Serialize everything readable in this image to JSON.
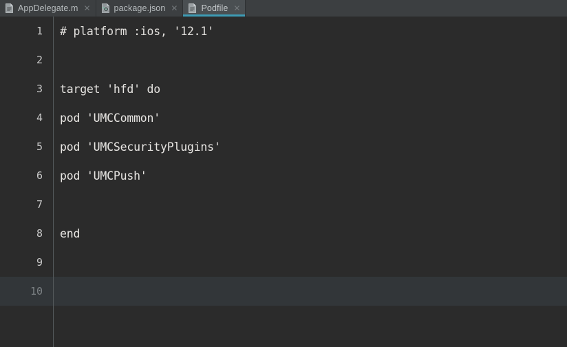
{
  "window": {
    "background_color": "#2b2b2b",
    "tabbar_color": "#3c3f41",
    "active_tab_color": "#4a4f52",
    "accent_color": "#3d9cb5",
    "gutter_rule_color": "#555a5c",
    "current_line_color": "#323639",
    "code_text_color": "#e8e6e3",
    "line_number_color": "#c8c8c8"
  },
  "tabs": [
    {
      "label": "AppDelegate.m",
      "icon": "objective-c-file-icon",
      "active": false,
      "close_glyph": "✕"
    },
    {
      "label": "package.json",
      "icon": "npm-package-file-icon",
      "active": false,
      "close_glyph": "✕"
    },
    {
      "label": "Podfile",
      "icon": "ruby-file-icon",
      "active": true,
      "close_glyph": "✕"
    }
  ],
  "editor": {
    "file": "Podfile",
    "language": "ruby",
    "current_line": 10,
    "lines": [
      {
        "number": "1",
        "text": "# platform :ios, '12.1'",
        "kind": "comment"
      },
      {
        "number": "2",
        "text": "",
        "kind": "code"
      },
      {
        "number": "3",
        "text": "target 'hfd' do",
        "kind": "code"
      },
      {
        "number": "4",
        "text": "pod 'UMCCommon'",
        "kind": "code"
      },
      {
        "number": "5",
        "text": "pod 'UMCSecurityPlugins'",
        "kind": "code"
      },
      {
        "number": "6",
        "text": "pod 'UMCPush'",
        "kind": "code"
      },
      {
        "number": "7",
        "text": "",
        "kind": "code"
      },
      {
        "number": "8",
        "text": "end",
        "kind": "code"
      },
      {
        "number": "9",
        "text": "",
        "kind": "code"
      },
      {
        "number": "10",
        "text": "",
        "kind": "code"
      }
    ]
  }
}
